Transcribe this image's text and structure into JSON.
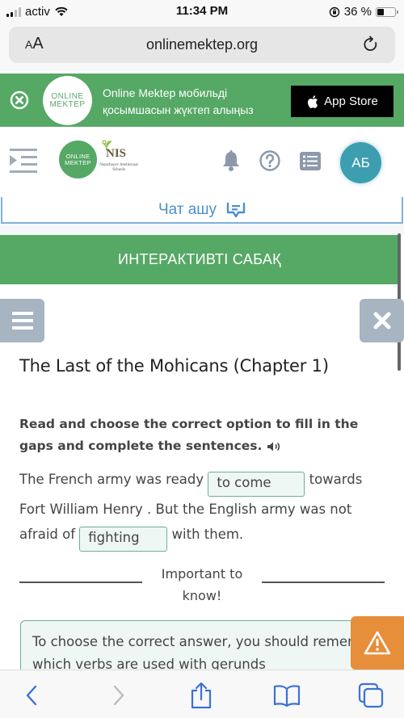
{
  "status_bar": {
    "carrier": "activ",
    "time": "11:34 PM",
    "battery_percent_label": "36 %",
    "battery_level": 0.36
  },
  "browser": {
    "text_size_label_small": "A",
    "text_size_label_large": "A",
    "url": "onlinemektep.org"
  },
  "app_banner": {
    "logo_line1": "ONLINE",
    "logo_line2": "MEKTEP",
    "message_line1": "Online Mektep мобильді",
    "message_line2": "қосымшасын жүктеп алыңыз",
    "store_button": "App Store"
  },
  "header": {
    "logo_line1": "ONLINE",
    "logo_line2": "MEKTEP",
    "nis_title": "NIS",
    "nis_subtitle": "Nazarbayev Intellectual Schools",
    "avatar_initials": "АБ"
  },
  "chat": {
    "label": "Чат ашу"
  },
  "section": {
    "title": "ИНТЕРАКТИВТІ САБАҚ"
  },
  "lesson": {
    "title": "The Last of the Mohicans (Chapter 1)",
    "instruction": "Read and choose the correct option to fill in the gaps and complete the sentences.",
    "text_part1": "The French army was ready",
    "gap1_value": "to come",
    "text_part2": "towards Fort William Henry . But the English army was not afraid of",
    "gap2_value": "fighting",
    "text_part3": "with them."
  },
  "important": {
    "label": "Important to know!"
  },
  "notice": {
    "text": "To choose the correct answer, you should remember which verbs are used with gerunds"
  },
  "colors": {
    "brand_green": "#56a865",
    "avatar_teal": "#3d9eb0",
    "chat_blue": "#4a8fcf",
    "warning_orange": "#e78e3a",
    "side_button_gray": "#a7b4c2",
    "gap_border": "#6fae98"
  }
}
